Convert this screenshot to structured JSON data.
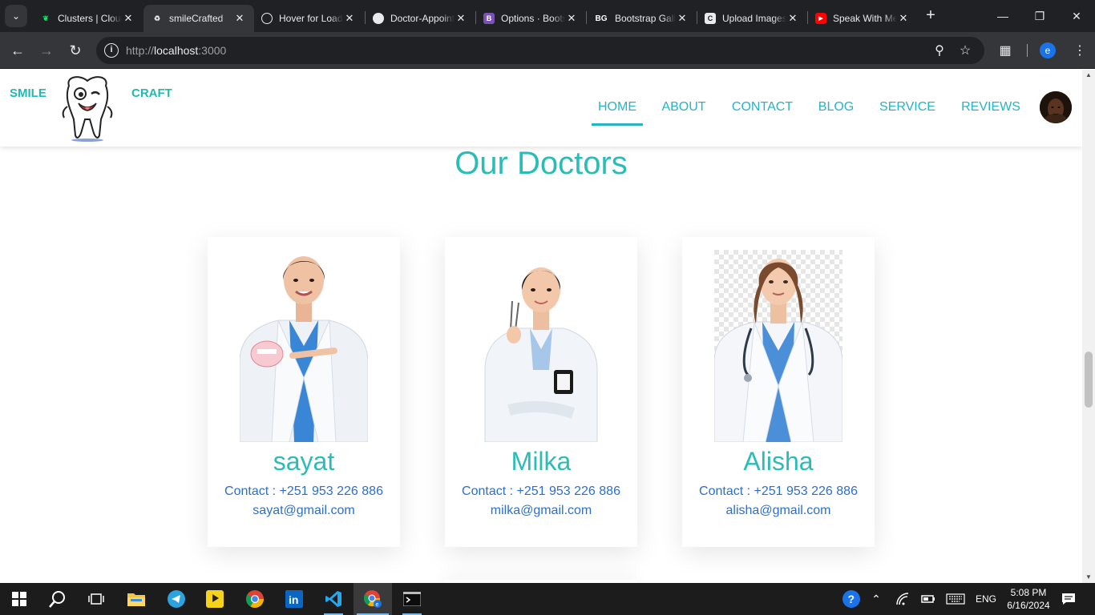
{
  "browser": {
    "tabs": [
      {
        "title": "Clusters | Cloud",
        "favicon": "mongodb-leaf-icon",
        "active": false
      },
      {
        "title": "smileCrafted",
        "favicon": "react-app-icon",
        "active": true
      },
      {
        "title": "Hover for Loading",
        "favicon": "chatgpt-icon",
        "active": false
      },
      {
        "title": "Doctor-Appointment",
        "favicon": "github-icon",
        "active": false
      },
      {
        "title": "Options · Bootstrap",
        "favicon": "bootstrap-icon",
        "active": false
      },
      {
        "title": "Bootstrap Gallery",
        "favicon": "bg-icon",
        "active": false
      },
      {
        "title": "Upload Images",
        "favicon": "cloudinary-icon",
        "active": false
      },
      {
        "title": "Speak With Me",
        "favicon": "youtube-icon",
        "active": false
      }
    ],
    "address": {
      "scheme": "http://",
      "host": "localhost",
      "port": ":3000"
    },
    "profile_initial": "e"
  },
  "site": {
    "brand_left": "SMILE",
    "brand_right": "CRAFT",
    "nav": [
      {
        "label": "HOME",
        "active": true
      },
      {
        "label": "ABOUT",
        "active": false
      },
      {
        "label": "CONTACT",
        "active": false
      },
      {
        "label": "BLOG",
        "active": false
      },
      {
        "label": "SERVICE",
        "active": false
      },
      {
        "label": "REVIEWS",
        "active": false
      }
    ],
    "section_title": "Our Doctors",
    "doctors": [
      {
        "name": "sayat",
        "contact": "Contact : +251 953 226 886",
        "email": "sayat@gmail.com"
      },
      {
        "name": "Milka",
        "contact": "Contact : +251 953 226 886",
        "email": "milka@gmail.com"
      },
      {
        "name": "Alisha",
        "contact": "Contact : +251 953 226 886",
        "email": "alisha@gmail.com"
      }
    ]
  },
  "taskbar": {
    "language": "ENG",
    "time": "5:08 PM",
    "date": "6/16/2024"
  },
  "colors": {
    "teal": "#2bbcb8",
    "nav": "#26b3c4",
    "link_blue": "#2b6fd1"
  }
}
